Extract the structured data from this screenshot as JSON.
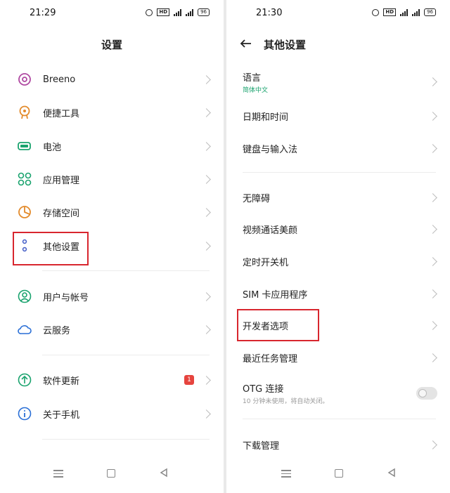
{
  "left": {
    "status": {
      "time": "21:29",
      "hd": "HD",
      "battery": "96",
      "signal1": "4G",
      "signal2": "4G"
    },
    "title": "设置",
    "items": [
      {
        "label": "Breeno",
        "icon": "breeno-icon"
      },
      {
        "label": "便捷工具",
        "icon": "tools-icon"
      },
      {
        "label": "电池",
        "icon": "battery-icon"
      },
      {
        "label": "应用管理",
        "icon": "apps-icon"
      },
      {
        "label": "存储空间",
        "icon": "storage-icon"
      },
      {
        "label": "其他设置",
        "icon": "more-settings-icon"
      },
      {
        "label": "用户与帐号",
        "icon": "account-icon"
      },
      {
        "label": "云服务",
        "icon": "cloud-icon"
      },
      {
        "label": "软件更新",
        "icon": "update-icon",
        "badge": "1"
      },
      {
        "label": "关于手机",
        "icon": "info-icon"
      }
    ]
  },
  "right": {
    "status": {
      "time": "21:30",
      "hd": "HD",
      "battery": "96",
      "signal1": "4G",
      "signal2": "4G"
    },
    "title": "其他设置",
    "items": [
      {
        "label": "语言",
        "sub": "简体中文"
      },
      {
        "label": "日期和时间"
      },
      {
        "label": "键盘与输入法"
      },
      {
        "label": "无障碍"
      },
      {
        "label": "视频通话美颜"
      },
      {
        "label": "定时开关机"
      },
      {
        "label": "SIM 卡应用程序"
      },
      {
        "label": "开发者选项"
      },
      {
        "label": "最近任务管理"
      },
      {
        "label": "OTG 连接",
        "sub": "10 分钟未使用，将自动关闭。",
        "toggle": "off"
      },
      {
        "label": "下载管理"
      }
    ]
  },
  "colors": {
    "accent_green": "#1aa36e",
    "highlight_red": "#d8262e",
    "badge_red": "#e6443e"
  }
}
